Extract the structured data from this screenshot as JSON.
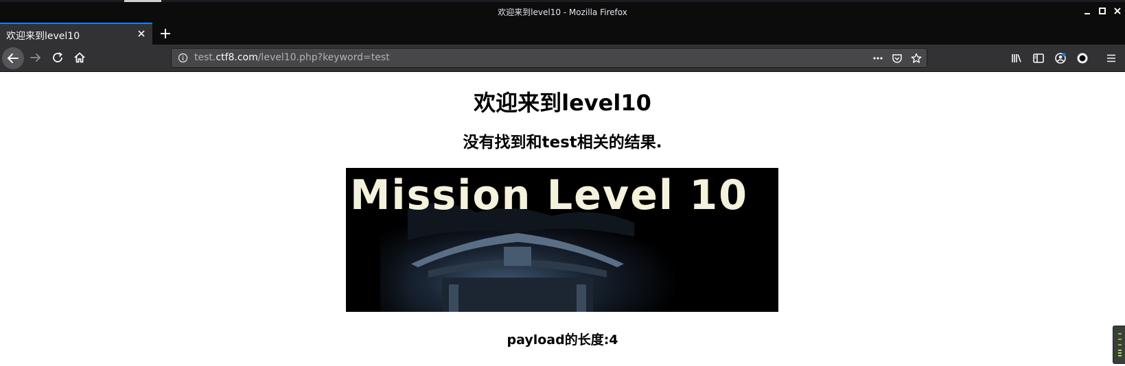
{
  "window": {
    "title": "欢迎来到level10 - Mozilla Firefox",
    "controls": [
      "minimize-icon",
      "maximize-icon",
      "close-icon"
    ]
  },
  "tabs": [
    {
      "label": "欢迎来到level10",
      "active": true
    }
  ],
  "toolbar": {
    "url_prefix": "test.",
    "url_host": "ctf8.com",
    "url_path": "/level10.php?keyword=test",
    "icons": [
      "back-icon",
      "forward-icon",
      "reload-icon",
      "home-icon",
      "page-actions-icon",
      "pocket-icon",
      "bookmark-star-icon",
      "library-icon",
      "sidebar-icon",
      "account-icon",
      "extension-icon",
      "menu-icon"
    ]
  },
  "page": {
    "heading": "欢迎来到level10",
    "result_text": "没有找到和test相关的结果.",
    "banner_text": "Mission Level 10",
    "payload_text": "payload的长度:4"
  },
  "colors": {
    "chrome_dark": "#0c0c0d",
    "toolbar": "#323234",
    "urlbar": "#474749",
    "tab_accent": "#0a84ff",
    "banner_text": "#f4f1dc"
  }
}
